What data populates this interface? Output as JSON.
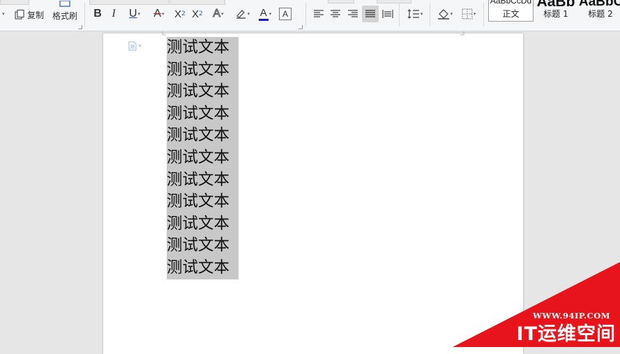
{
  "ribbon": {
    "clipboard": {
      "copy_label": "复制",
      "format_painter_label": "格式刷"
    },
    "font": {
      "bold": "B",
      "italic": "I",
      "underline": "U",
      "strike": "A",
      "superscript_base": "X",
      "superscript_mark": "2",
      "subscript_base": "X",
      "subscript_mark": "2",
      "text_effect": "A",
      "font_color": "A",
      "char_border": "A",
      "underline_color": "#1a4fc4",
      "font_color_bar": "#1a1acb",
      "strike_color": "#d21f1f"
    },
    "styles": [
      {
        "preview": "AaBbCcDd",
        "name": "正文",
        "active": true
      },
      {
        "preview": "AaBb",
        "name": "标题 1",
        "active": false
      },
      {
        "preview": "AaBbC",
        "name": "标题 2",
        "active": false
      }
    ]
  },
  "document": {
    "lines": [
      "测试文本",
      "测试文本",
      "测试文本",
      "测试文本",
      "测试文本",
      "测试文本",
      "测试文本",
      "测试文本",
      "测试文本",
      "测试文本",
      "测试文本"
    ],
    "selection_color": "#c8c8c8"
  },
  "watermark": {
    "url": "WWW.94IP.COM",
    "title": "IT运维空间",
    "color": "#e8141b"
  }
}
